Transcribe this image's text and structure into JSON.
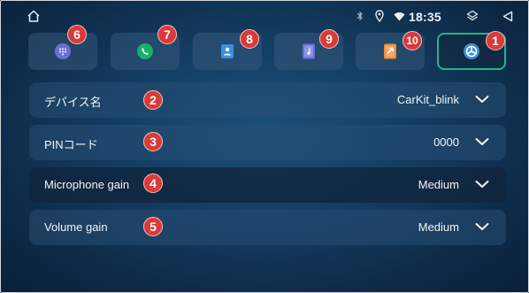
{
  "status_bar": {
    "time": "18:35",
    "icons": [
      "home-icon",
      "bluetooth-icon",
      "location-icon",
      "wifi-icon",
      "layers-icon",
      "back-icon"
    ]
  },
  "tabs": [
    {
      "name": "dialpad",
      "icon": "dialpad-icon",
      "badge": "6",
      "color": "#6a6fd6"
    },
    {
      "name": "phone",
      "icon": "phone-icon",
      "badge": "7",
      "color": "#19b16a"
    },
    {
      "name": "contacts",
      "icon": "contacts-icon",
      "badge": "8",
      "color": "#3d8fd9"
    },
    {
      "name": "music",
      "icon": "music-icon",
      "badge": "9",
      "color": "#6a6fd6"
    },
    {
      "name": "phone-mirror",
      "icon": "phone-mirror-icon",
      "badge": "10",
      "color": "#f08a3a"
    },
    {
      "name": "settings",
      "icon": "settings-icon",
      "badge": "1",
      "color": "#3d8fd9",
      "active": true
    }
  ],
  "settings": [
    {
      "label": "デバイス名",
      "value": "CarKit_blink",
      "badge": "2"
    },
    {
      "label": "PINコード",
      "value": "0000",
      "badge": "3"
    },
    {
      "label": "Microphone gain",
      "value": "Medium",
      "badge": "4"
    },
    {
      "label": "Volume gain",
      "value": "Medium",
      "badge": "5"
    }
  ],
  "colors": {
    "accent": "#22b589",
    "badge": "#d93a3a"
  }
}
